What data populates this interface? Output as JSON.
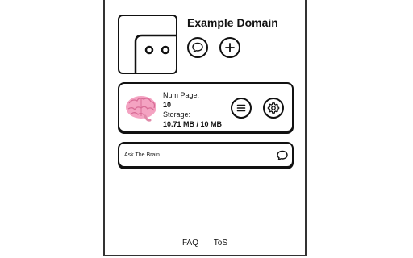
{
  "header": {
    "title": "Example Domain",
    "logo_icon": "robot-face-icon",
    "chat_icon": "chat-bubble-icon",
    "add_icon": "plus-icon"
  },
  "stats": {
    "num_page_label": "Num Page:",
    "num_page_value": "10",
    "storage_label": "Storage:",
    "storage_value": "10.71 MB / 10 MB",
    "brain_icon": "brain-icon",
    "menu_icon": "menu-icon",
    "settings_icon": "gear-icon"
  },
  "ask": {
    "placeholder": "Ask The Brain",
    "send_icon": "chat-bubble-icon"
  },
  "footer": {
    "faq": "FAQ",
    "tos": "ToS"
  },
  "colors": {
    "border": "#111111",
    "brain_pink": "#f4a3c2"
  }
}
